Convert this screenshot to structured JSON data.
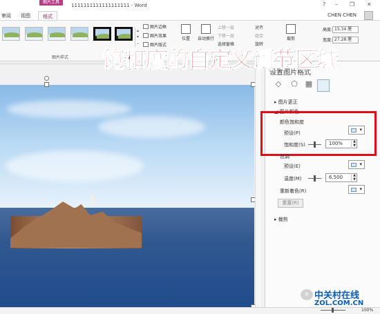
{
  "window": {
    "tool_tab": "图片工具",
    "title": "1111111111111111111 - Word",
    "help": "?",
    "minimize": "–",
    "restore": "❐",
    "close": "✕"
  },
  "tabs": {
    "review": "审阅",
    "view": "视图",
    "format": "格式"
  },
  "user": {
    "name": "CHEN CHEN"
  },
  "ribbon": {
    "picture_border": "图片边框",
    "picture_effects": "图片效果",
    "picture_layout": "图片版式",
    "picture_styles_group": "图片样式",
    "position": "位置",
    "wrap_text": "自动换行",
    "bring_forward": "上移一层",
    "send_backward": "下移一层",
    "selection_pane": "选择窗格",
    "align": "对齐",
    "group": "组合",
    "rotate": "旋转",
    "crop": "裁剪",
    "height_label": "高度:",
    "height_value": "15.34 厘",
    "width_label": "宽度:",
    "width_value": "27.28 厘"
  },
  "overlay": {
    "caption": "饱和度的自定义调节区域"
  },
  "pane": {
    "title": "设置图片格式",
    "picture_corrections": "图片更正",
    "picture_color": "图片颜色",
    "color_saturation": "颜色饱和度",
    "preset_p": "预设(P)",
    "saturation_label": "饱和度(S)",
    "saturation_value": "100%",
    "saturation_level": 1.0,
    "color_tone": "色调",
    "preset_e": "预设(E)",
    "temperature_label": "温度(M)",
    "temperature_value": "6,500",
    "recolor": "重新着色(R)",
    "reset": "重置(R)",
    "crop": "裁剪"
  },
  "status": {
    "zoom": "100%"
  },
  "watermark": {
    "name_cn": "中关村在线",
    "site": "ZOL.COM.CN",
    "mark": "值"
  },
  "colors": {
    "accent": "#b83d87",
    "highlight": "#e30b18",
    "watermark": "#0b5db5"
  }
}
